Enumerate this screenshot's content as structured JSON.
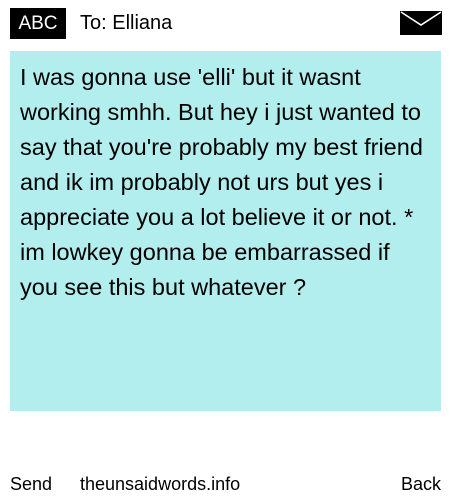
{
  "header": {
    "badge": "ABC",
    "recipient": "To: Elliana",
    "envelope_icon": "envelope-icon"
  },
  "message": {
    "text": "I was gonna use 'elli' but it wasnt working smhh. But hey i just wanted to say that you're probably my best friend and ik im probably not urs but yes i appreciate you a lot believe it or not. * im lowkey gonna be embarrassed if you see this but whatever ?",
    "background_color": "#b2eeee"
  },
  "footer": {
    "send_label": "Send",
    "site_label": "theunsaidwords.info",
    "back_label": "Back"
  }
}
